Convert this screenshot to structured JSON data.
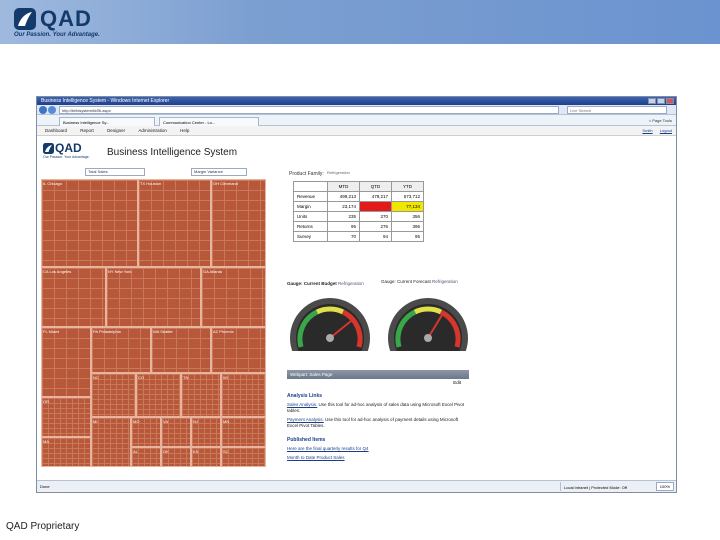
{
  "header": {
    "logo_text": "QAD",
    "tagline": "Our Passion. Your Advantage.",
    "bg_color": "#7c9fd1"
  },
  "browser": {
    "title": "Business Intelligence System - Windows Internet Explorer",
    "address": "http://bi/bisystem/bi/BI.aspx",
    "search_placeholder": "Live Search",
    "tabs": [
      "Business Intelligence Sy...",
      "Communication Center - Lo..."
    ],
    "tools": [
      "Page",
      "Tools"
    ],
    "menu": [
      "Dashboard",
      "Report",
      "Designer",
      "Administration",
      "Help"
    ],
    "user": {
      "name": "Smith",
      "links": [
        "Logout"
      ]
    },
    "status": {
      "left": "Done",
      "zone": "Local intranet | Protected Mode: Off",
      "zoom": "100%"
    }
  },
  "app": {
    "logo_text": "QAD",
    "logo_tagline": "Our Passion. Your Advantage.",
    "title": "Business Intelligence System",
    "selectors": [
      "Total Sales",
      "Margin Variance"
    ],
    "treemap_labels": {
      "a": "Chicago",
      "b": "Los Angeles",
      "c": "Dallas",
      "d": "Cleveland",
      "e": "Sacramento",
      "f": "Boston",
      "g": "Seattle",
      "h": "Houston",
      "i": "Atlanta",
      "j": "New York",
      "k": "Raleigh",
      "l": "Phoenix",
      "m": "Orlando",
      "n": "Denver",
      "o": "Tampa",
      "p": "Miami",
      "q": "Philadelphia",
      "r": "Memphis",
      "s": "Milwaukee",
      "t": "Portland",
      "u": "Nashville"
    },
    "treemap_states": [
      "IL",
      "TX",
      "OH",
      "CA",
      "NY",
      "GA",
      "FL",
      "PA",
      "WA",
      "AZ",
      "NC",
      "CO",
      "TN",
      "WI",
      "OR",
      "MA",
      "MI",
      "MO",
      "VA",
      "NJ",
      "MN",
      "AL",
      "OK",
      "KS",
      "SC"
    ],
    "product_family_label": "Product Family:",
    "product_family_value": "Refrigeration",
    "table": {
      "columns": [
        "MTD",
        "QTD",
        "YTD"
      ],
      "rows": [
        {
          "label": "Revenue",
          "values": [
            "499,213",
            "479,217",
            "573,712"
          ]
        },
        {
          "label": "Margin",
          "values": [
            "23,174",
            "",
            "77,134"
          ]
        },
        {
          "label": "Units",
          "values": [
            "235",
            "270",
            "356"
          ]
        },
        {
          "label": "Returns",
          "values": [
            "95",
            "276",
            "396"
          ]
        },
        {
          "label": "Survey",
          "values": [
            "70",
            "94",
            "95"
          ]
        }
      ]
    },
    "gauge1": {
      "label": "Gauge: Current Budget",
      "select": "Refrigeration"
    },
    "gauge2": {
      "label": "Gauge: Current Forecast",
      "select": "Refrigeration"
    },
    "webpart": {
      "title": "Webpart: Sales Page",
      "edit": "Edit",
      "analysis_heading": "Analysis Links",
      "analysis_items": [
        {
          "link": "Sales Analysis.",
          "text": " Use this tool for ad-hoc analysis of sales data using Microsoft Excel Pivot tables."
        },
        {
          "link": "Payment Analysis.",
          "text": " Use this tool for ad-hoc analysis of payment details using Microsoft Excel Pivot Tables."
        }
      ],
      "published_heading": "Published Items",
      "published_items": [
        "Here are the final quarterly results for Q4",
        "Month to Date Product Sales"
      ]
    }
  },
  "footer": {
    "text": "QAD Proprietary"
  }
}
